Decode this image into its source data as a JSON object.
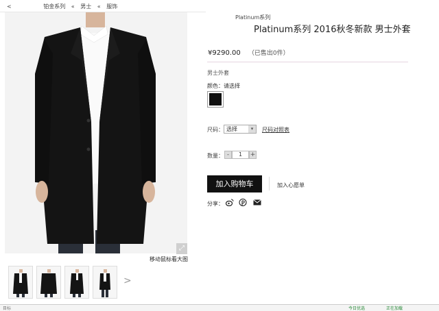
{
  "breadcrumb": {
    "back": "<",
    "items": [
      "铂金系列",
      "男士",
      "服饰"
    ],
    "separator": "«"
  },
  "gallery": {
    "zoom_icon": "expand-icon",
    "zoom_hint": "移动鼠标看大图",
    "next_arrow": ">"
  },
  "product": {
    "collection": "Platinum系列",
    "title": "Platinum系列 2016秋冬新款 男士外套",
    "price": "¥9290.00",
    "sold": "（已售出0件）",
    "category": "男士外套",
    "color_label": "颜色：请选择",
    "color_swatch": "#111111",
    "size_label": "尺码：",
    "size_select": "选择",
    "size_guide": "尺码对照表",
    "qty_label": "数量：",
    "qty_minus": "-",
    "qty_value": "1",
    "qty_plus": "+",
    "add_to_cart": "加入购物车",
    "wishlist": "加入心愿单",
    "share_label": "分享："
  },
  "status_bar": {
    "left": "目标",
    "right1": "今日优选",
    "right2": "正在加载"
  }
}
